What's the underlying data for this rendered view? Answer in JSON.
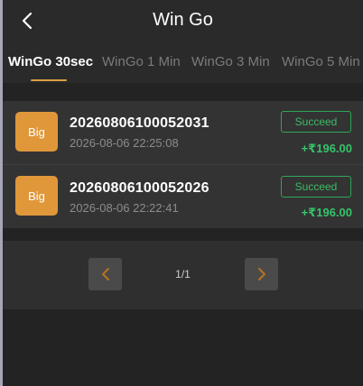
{
  "header": {
    "title": "Win Go"
  },
  "tabs": [
    {
      "label": "WinGo 30sec",
      "active": true
    },
    {
      "label": "WinGo 1 Min",
      "active": false
    },
    {
      "label": "WinGo 3 Min",
      "active": false
    },
    {
      "label": "WinGo 5 Min",
      "active": false
    }
  ],
  "records": [
    {
      "bet": "Big",
      "period": "20260806100052031",
      "time": "2026-08-06 22:25:08",
      "status": "Succeed",
      "amount": "+₹196.00"
    },
    {
      "bet": "Big",
      "period": "20260806100052026",
      "time": "2026-08-06 22:22:41",
      "status": "Succeed",
      "amount": "+₹196.00"
    }
  ],
  "pagination": {
    "label": "1/1"
  },
  "colors": {
    "accent": "#d8a042",
    "badge": "#e0973a",
    "success": "#35c36b",
    "background": "#2b2b2b"
  },
  "icons": {
    "back": "chevron-left-icon",
    "prev": "chevron-left-icon",
    "next": "chevron-right-icon"
  }
}
